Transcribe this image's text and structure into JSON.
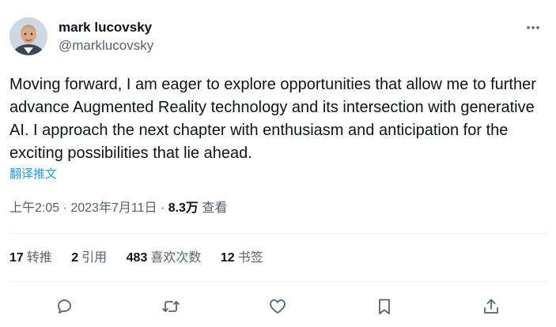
{
  "author": {
    "display_name": "mark lucovsky",
    "handle": "@marklucovsky"
  },
  "tweet": {
    "text": "Moving forward, I am eager to explore opportunities that allow me to further advance Augmented Reality technology and its intersection with generative AI. I approach the next chapter with enthusiasm and anticipation for the exciting possibilities that lie ahead.",
    "translate_label": "翻译推文",
    "time": "上午2:05 · 2023年7月11日 · ",
    "views_count": "8.3万",
    "views_label": " 查看"
  },
  "stats": [
    {
      "count": "17",
      "label": "转推"
    },
    {
      "count": "2",
      "label": "引用"
    },
    {
      "count": "483",
      "label": "喜欢次数"
    },
    {
      "count": "12",
      "label": "书签"
    }
  ],
  "icons": {
    "more": "more-horizontal-icon",
    "reply": "reply-icon",
    "retweet": "retweet-icon",
    "like": "heart-icon",
    "bookmark": "bookmark-icon",
    "share": "share-icon"
  },
  "colors": {
    "text_primary": "#0f1419",
    "text_secondary": "#536471",
    "link": "#1d9bf0",
    "divider": "#eff3f4"
  }
}
